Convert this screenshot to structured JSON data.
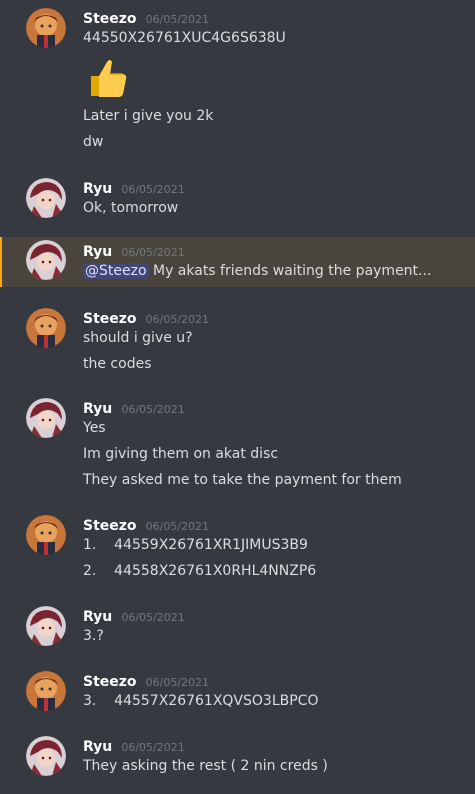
{
  "colors": {
    "background": "#36393f",
    "mention_highlight_bg": "#49443c",
    "mention_highlight_border": "#faa81a",
    "mention_pill_bg": "#414675",
    "username": "#ffffff",
    "timestamp": "#72767d",
    "message_text": "#dcddde"
  },
  "messages": [
    {
      "author": "Steezo",
      "timestamp": "06/05/2021",
      "lines": [
        "44550X26761XUC4G6S638U"
      ],
      "emoji": "thumbs-up-icon",
      "extra_lines": [
        "Later i give you 2k",
        "dw"
      ]
    },
    {
      "author": "Ryu",
      "timestamp": "06/05/2021",
      "lines": [
        "Ok, tomorrow"
      ]
    },
    {
      "author": "Ryu",
      "timestamp": "06/05/2021",
      "mention": "@Steezo",
      "lines": [
        "My akats friends waiting the payment..."
      ]
    },
    {
      "author": "Steezo",
      "timestamp": "06/05/2021",
      "lines": [
        "should i give u?",
        "the codes"
      ]
    },
    {
      "author": "Ryu",
      "timestamp": "06/05/2021",
      "lines": [
        "Yes",
        "Im giving them on akat disc",
        "They asked me to take the payment for them"
      ]
    },
    {
      "author": "Steezo",
      "timestamp": "06/05/2021",
      "lines": [
        "1.    44559X26761XR1JIMUS3B9",
        "2.    44558X26761X0RHL4NNZP6"
      ]
    },
    {
      "author": "Ryu",
      "timestamp": "06/05/2021",
      "lines": [
        "3.?"
      ]
    },
    {
      "author": "Steezo",
      "timestamp": "06/05/2021",
      "lines": [
        "3.    44557X26761XQVSO3LBPCO"
      ]
    },
    {
      "author": "Ryu",
      "timestamp": "06/05/2021",
      "lines": [
        "They asking the rest ( 2 nin creds )"
      ]
    }
  ]
}
